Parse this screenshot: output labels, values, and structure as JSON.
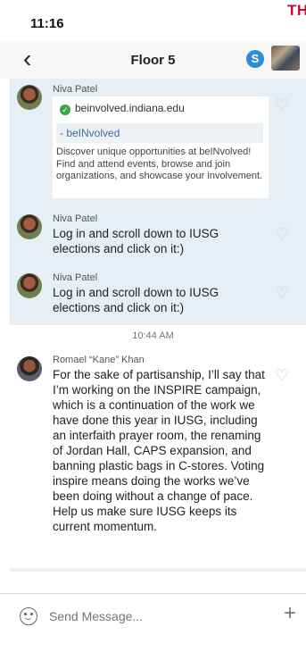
{
  "status_bar": {
    "time": "11:16",
    "banner_text": "TH"
  },
  "header": {
    "back_glyph": "‹",
    "title": "Floor 5",
    "skype_glyph": "S"
  },
  "messages": [
    {
      "sender": "Niva Patel",
      "link_preview": {
        "host": "beinvolved.indiana.edu",
        "title": "- beINvolved",
        "description": "Discover unique opportunities at beINvolved! Find and attend events, browse and join organizations, and showcase your involvement."
      }
    },
    {
      "sender": "Niva Patel",
      "text": "Log in and scroll down to IUSG elections and click on it:)"
    },
    {
      "sender": "Niva Patel",
      "text": "Log in and scroll down to IUSG elections and click on it:)"
    },
    {
      "timestamp": "10:44 AM",
      "sender": "Romael “Kane” Khan",
      "text": "For the sake of partisanship, I’ll say that I’m working on the INSPIRE campaign, which is a continuation of the work we have done this year in IUSG, including an interfaith prayer room, the renaming of Jordan Hall, CAPS expansion, and banning plastic bags in C-stores. Voting inspire means doing the works we’ve been doing without a change of pace. Help us make sure IUSG keeps its current momentum."
    }
  ],
  "composer": {
    "placeholder": "Send Message...",
    "plus_glyph": "+"
  },
  "icons": {
    "back": "chevron-left-icon",
    "skype": "skype-icon",
    "heart": "heart-outline-icon",
    "verified": "check-circle-icon",
    "emoji": "smiley-icon",
    "plus": "plus-icon"
  },
  "colors": {
    "highlight_bg": "#e6eef6",
    "link_title": "#3b6ea8",
    "banner_text": "#c8102e",
    "skype_blue": "#2e8cd8",
    "verified_green": "#3aa54a"
  }
}
